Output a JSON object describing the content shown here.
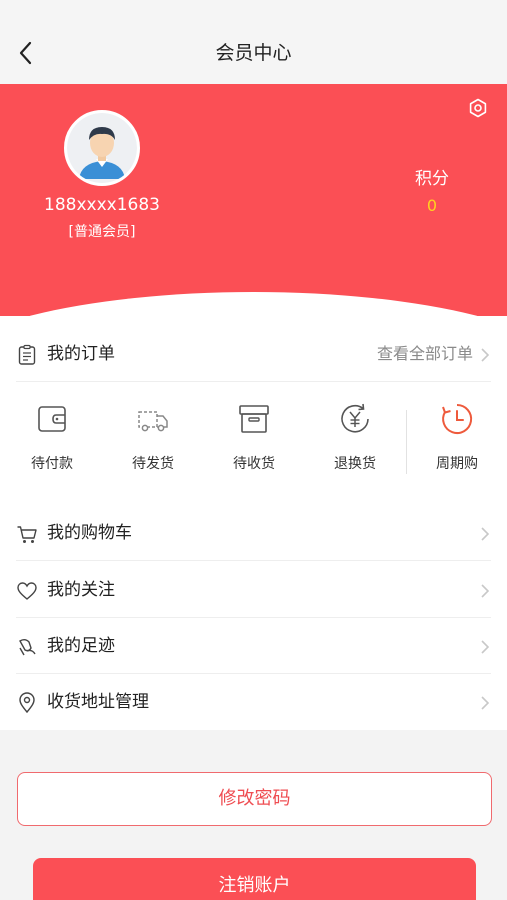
{
  "nav": {
    "title": "会员中心"
  },
  "profile": {
    "phone": "188xxxx1683",
    "level": "[普通会员]"
  },
  "points": {
    "label": "积分",
    "value": "0"
  },
  "orders": {
    "title": "我的订单",
    "view_all": "查看全部订单",
    "statuses": [
      {
        "label": "待付款",
        "icon": "wallet-icon"
      },
      {
        "label": "待发货",
        "icon": "truck-icon"
      },
      {
        "label": "待收货",
        "icon": "box-icon"
      },
      {
        "label": "退换货",
        "icon": "yen-refund-icon"
      },
      {
        "label": "周期购",
        "icon": "clock-icon"
      }
    ]
  },
  "menu": [
    {
      "label": "我的购物车",
      "icon": "cart-icon"
    },
    {
      "label": "我的关注",
      "icon": "heart-icon"
    },
    {
      "label": "我的足迹",
      "icon": "footprint-icon"
    },
    {
      "label": "收货地址管理",
      "icon": "location-pin-icon"
    }
  ],
  "buttons": {
    "change_password": "修改密码",
    "cancel_account": "注销账户"
  },
  "colors": {
    "brand_red": "#fb4f55",
    "points_yellow": "#ffd21f",
    "cycle_orange": "#ee5a3c"
  }
}
